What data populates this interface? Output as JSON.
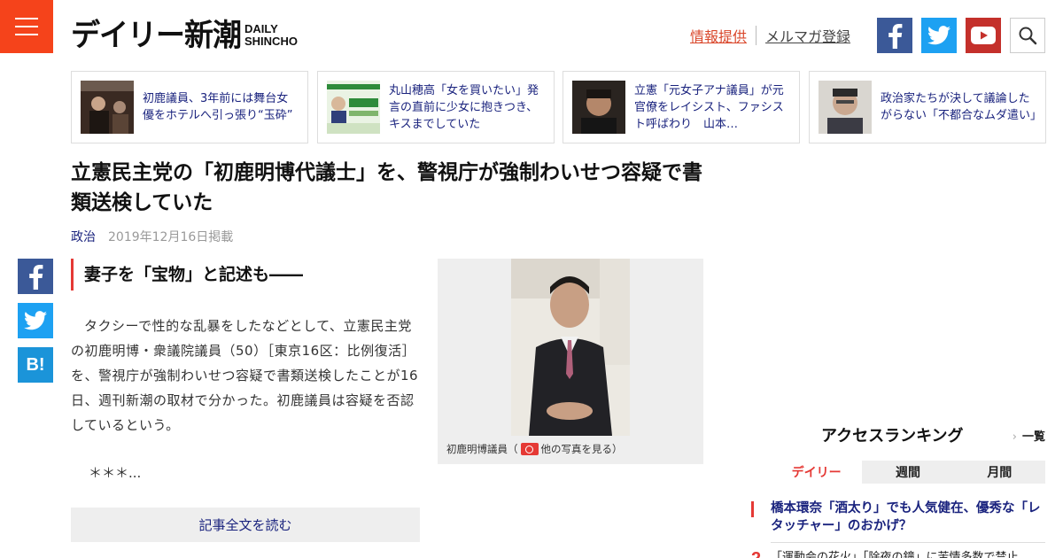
{
  "header": {
    "logo_jp": "デイリー新潮",
    "logo_en_line1": "DAILY",
    "logo_en_line2": "SHINCHO",
    "link_info": "情報提供",
    "link_mail": "メルマガ登録",
    "social": [
      "facebook-icon",
      "twitter-icon",
      "youtube-icon"
    ],
    "search_icon": "search-icon",
    "menu_icon": "hamburger-menu-icon",
    "accent_color": "#f5431b"
  },
  "related": [
    {
      "text": "初鹿議員、3年前には舞台女優をホテルへ引っ張り“玉砕”"
    },
    {
      "text": "丸山穂高「女を買いたい」発言の直前に少女に抱きつき、キスまでしていた"
    },
    {
      "text": "立憲「元女子アナ議員」が元官僚をレイシスト、ファシスト呼ばわり　山本…"
    },
    {
      "text": "政治家たちが決して議論したがらない「不都合なムダ遣い」"
    }
  ],
  "article": {
    "title": "立憲民主党の「初鹿明博代議士」を、警視庁が強制わいせつ容疑で書類送検していた",
    "category": "政治",
    "date": "2019年12月16日掲載",
    "subhead": "妻子を「宝物」と記述も――",
    "body": "タクシーで性的な乱暴をしたなどとして、立憲民主党の初鹿明博・衆議院議員（50）［東京16区：比例復活］を、警視庁が強制わいせつ容疑で書類送検したことが16日、週刊新潮の取材で分かった。初鹿議員は容疑を否認しているという。",
    "ellipsis": "＊＊＊...",
    "read_more": "記事全文を読む",
    "photo_caption_pre": "初鹿明博議員（",
    "photo_caption_link": "他の写真を見る）"
  },
  "share": {
    "hatena_label": "B!"
  },
  "ranking": {
    "title": "アクセスランキング",
    "all_link": "一覧",
    "tabs": [
      "デイリー",
      "週間",
      "月間"
    ],
    "active_tab": "デイリー",
    "items": [
      {
        "rank": "1",
        "text": "橋本環奈「酒太り」でも人気健在、優秀な「レタッチャー」のおかげ？"
      },
      {
        "rank": "2",
        "text": "「運動会の花火」「除夜の鐘」に苦情多数で禁止"
      }
    ]
  }
}
